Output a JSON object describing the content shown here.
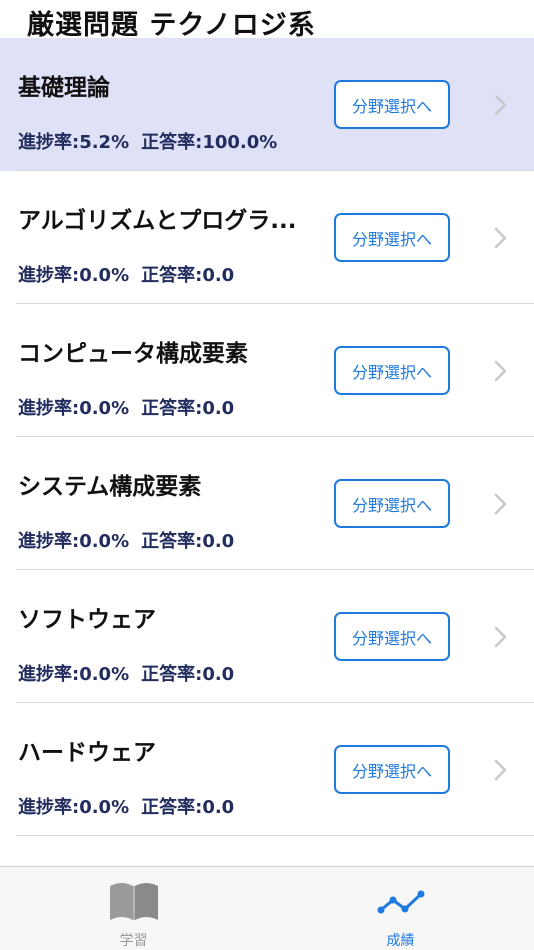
{
  "header": {
    "title": "厳選問題 テクノロジ系"
  },
  "rows": [
    {
      "title": "基礎理論",
      "progress": "進捗率:5.2%",
      "accuracy": "正答率:100.0%",
      "button": "分野選択へ"
    },
    {
      "title": "アルゴリズムとプログラ...",
      "progress": "進捗率:0.0%",
      "accuracy": "正答率:0.0",
      "button": "分野選択へ"
    },
    {
      "title": "コンピュータ構成要素",
      "progress": "進捗率:0.0%",
      "accuracy": "正答率:0.0",
      "button": "分野選択へ"
    },
    {
      "title": "システム構成要素",
      "progress": "進捗率:0.0%",
      "accuracy": "正答率:0.0",
      "button": "分野選択へ"
    },
    {
      "title": "ソフトウェア",
      "progress": "進捗率:0.0%",
      "accuracy": "正答率:0.0",
      "button": "分野選択へ"
    },
    {
      "title": "ハードウェア",
      "progress": "進捗率:0.0%",
      "accuracy": "正答率:0.0",
      "button": "分野選択へ"
    }
  ],
  "tabs": [
    {
      "label": "学習",
      "icon": "book-icon",
      "active": false
    },
    {
      "label": "成績",
      "icon": "chart-line-icon",
      "active": true
    }
  ],
  "colors": {
    "accent": "#1f7ae0",
    "selected_row": "#dfe1f6",
    "stats_text": "#222c5e",
    "inactive_tab": "#9a9a9a"
  }
}
